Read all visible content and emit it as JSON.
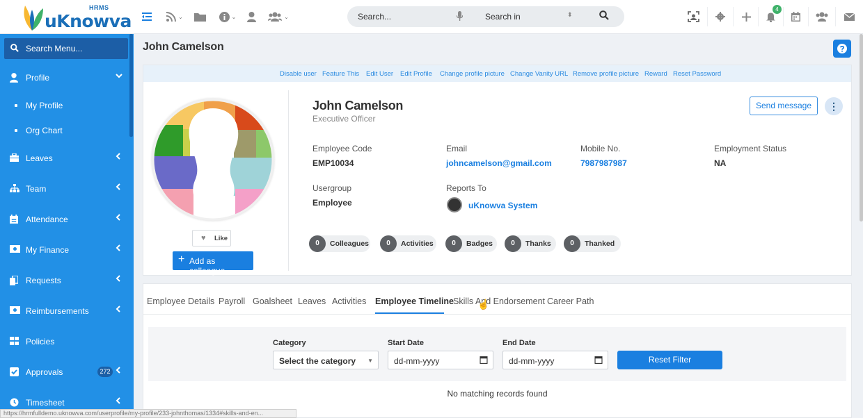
{
  "brand": {
    "hrms": "HRMS",
    "name": "uKnowva"
  },
  "topbar": {
    "search_placeholder": "Search...",
    "search_in": "Search in",
    "notification_count": "4"
  },
  "sidebar": {
    "search_label": "Search Menu...",
    "items": [
      {
        "label": "Profile",
        "icon": "user-icon"
      },
      {
        "label": "My Profile",
        "sub": true
      },
      {
        "label": "Org Chart",
        "sub": true
      },
      {
        "label": "Leaves",
        "icon": "briefcase-icon"
      },
      {
        "label": "Team",
        "icon": "sitemap-icon"
      },
      {
        "label": "Attendance",
        "icon": "calendar-icon"
      },
      {
        "label": "My Finance",
        "icon": "money-icon"
      },
      {
        "label": "Requests",
        "icon": "copy-icon"
      },
      {
        "label": "Reimbursements",
        "icon": "cash-icon"
      },
      {
        "label": "Policies",
        "icon": "grid-icon"
      },
      {
        "label": "Approvals",
        "icon": "check-square-icon",
        "badge": "272"
      },
      {
        "label": "Timesheet",
        "icon": "clock-icon"
      }
    ]
  },
  "page": {
    "title": "John Camelson"
  },
  "actions": [
    "Disable user",
    "Feature This",
    "Edit User",
    "Edit Profile",
    "Change profile picture",
    "Change Vanity URL",
    "Remove profile picture",
    "Reward",
    "Reset Password"
  ],
  "profile": {
    "name": "John Camelson",
    "title": "Executive Officer",
    "send_message": "Send message",
    "like": "Like",
    "add_colleague": "Add as colleague",
    "fields": {
      "employee_code_label": "Employee Code",
      "employee_code": "EMP10034",
      "email_label": "Email",
      "email": "johncamelson@gmail.com",
      "mobile_label": "Mobile No.",
      "mobile": "7987987987",
      "status_label": "Employment Status",
      "status": "NA",
      "usergroup_label": "Usergroup",
      "usergroup": "Employee",
      "reports_label": "Reports To",
      "reports_to": "uKnowva System"
    },
    "stats": [
      {
        "count": "0",
        "label": "Colleagues"
      },
      {
        "count": "0",
        "label": "Activities"
      },
      {
        "count": "0",
        "label": "Badges"
      },
      {
        "count": "0",
        "label": "Thanks"
      },
      {
        "count": "0",
        "label": "Thanked"
      }
    ]
  },
  "tabs": [
    "Employee Details",
    "Payroll",
    "Goalsheet",
    "Leaves",
    "Activities",
    "Employee Timeline",
    "Skills And Endorsement",
    "Career Path"
  ],
  "active_tab": "Employee Timeline",
  "filter": {
    "category_label": "Category",
    "category_value": "Select the category",
    "start_label": "Start Date",
    "start_value": "dd-mm-yyyy",
    "end_label": "End Date",
    "end_value": "dd-mm-yyyy",
    "reset": "Reset Filter"
  },
  "no_records": "No matching records found",
  "status_url": "https://hrmfulldemo.uknowva.com/userprofile/my-profile/233-johnthomas/1334#skills-and-en..."
}
